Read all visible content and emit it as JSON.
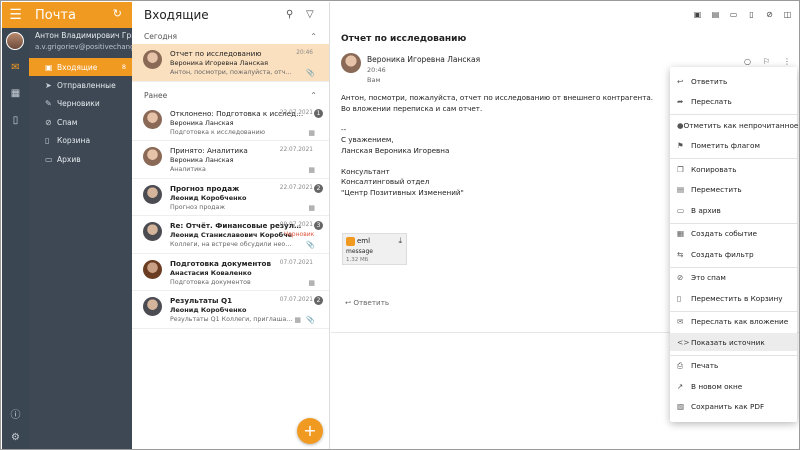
{
  "app": {
    "title": "Почта"
  },
  "account": {
    "name": "Антон Владимирович Григорьев",
    "email": "a.v.grigoriev@positivechange.ru"
  },
  "folders": [
    {
      "label": "Входящие",
      "count": "8",
      "icon": "inbox-icon"
    },
    {
      "label": "Отправленные",
      "count": "",
      "icon": "send-icon"
    },
    {
      "label": "Черновики",
      "count": "",
      "icon": "draft-icon"
    },
    {
      "label": "Спам",
      "count": "",
      "icon": "spam-icon"
    },
    {
      "label": "Корзина",
      "count": "",
      "icon": "trash-icon"
    },
    {
      "label": "Архив",
      "count": "",
      "icon": "archive-icon"
    }
  ],
  "list": {
    "title": "Входящие",
    "groups": {
      "today": "Сегодня",
      "earlier": "Ранее"
    },
    "messages": [
      {
        "subject": "Отчет по исследованию",
        "from": "Вероника Игоревна Ланская",
        "snippet": "Антон, посмотри, пожалуйста, отчет по внеш...",
        "date": "20:46",
        "count": "",
        "draft": "",
        "unread": false
      },
      {
        "subject": "Отклонено: Подготовка к исследованию",
        "from": "Вероника Ланская",
        "snippet": "Подготовка к исследованию",
        "date": "22.07.2021",
        "count": "1",
        "draft": "",
        "unread": false
      },
      {
        "subject": "Принято: Аналитика",
        "from": "Вероника Ланская",
        "snippet": "Аналитика",
        "date": "22.07.2021",
        "count": "",
        "draft": "",
        "unread": false
      },
      {
        "subject": "Прогноз продаж",
        "from": "Леонид Коробченко",
        "snippet": "Прогноз продаж",
        "date": "22.07.2021",
        "count": "2",
        "draft": "",
        "unread": true
      },
      {
        "subject": "Re: Отчёт. Финансовые результаты",
        "from": "Леонид Станиславович Коробче",
        "snippet": "Коллеги, на встрече обсудили необходим...",
        "date": "09.07.2021",
        "count": "3",
        "draft": "Черновик",
        "unread": true
      },
      {
        "subject": "Подготовка документов",
        "from": "Анастасия Коваленко",
        "snippet": "Подготовка документов",
        "date": "07.07.2021",
        "count": "",
        "draft": "",
        "unread": true
      },
      {
        "subject": "Результаты Q1",
        "from": "Леонид Коробченко",
        "snippet": "Результаты Q1 Коллеги, приглаша...",
        "date": "07.07.2021",
        "count": "2",
        "draft": "",
        "unread": true
      }
    ]
  },
  "reading": {
    "subject": "Отчет по исследованию",
    "from": "Вероника Игоревна Ланская",
    "time": "20:46",
    "to": "Вам",
    "body": [
      "Антон, посмотри, пожалуйста, отчет по исследованию от внешнего контрагента.",
      "Во вложении переписка и сам отчет.",
      "",
      "--",
      "С уважением,",
      "Ланская Вероника Игоревна",
      "",
      "Консультант",
      "Консалтинговый отдел",
      "\"Центр Позитивных Изменений\""
    ],
    "attachment": {
      "ext": "eml",
      "name": "message",
      "size": "1.32 МБ"
    },
    "reply_label": "Ответить"
  },
  "menu": {
    "items": [
      {
        "label": "Ответить",
        "icon": "reply-icon"
      },
      {
        "label": "Переслать",
        "icon": "forward-icon"
      },
      {
        "label": "Отметить как непрочитанное",
        "icon": "unread-dot-icon"
      },
      {
        "label": "Пометить флагом",
        "icon": "flag-icon"
      },
      {
        "label": "Копировать",
        "icon": "copy-icon"
      },
      {
        "label": "Переместить",
        "icon": "move-icon"
      },
      {
        "label": "В архив",
        "icon": "archive-icon"
      },
      {
        "label": "Создать событие",
        "icon": "calendar-icon"
      },
      {
        "label": "Создать фильтр",
        "icon": "filter-icon"
      },
      {
        "label": "Это спам",
        "icon": "spam-icon"
      },
      {
        "label": "Переместить в Корзину",
        "icon": "trash-icon"
      },
      {
        "label": "Переслать как вложение",
        "icon": "attach-forward-icon"
      },
      {
        "label": "Показать источник",
        "icon": "code-icon"
      },
      {
        "label": "Печать",
        "icon": "print-icon"
      },
      {
        "label": "В новом окне",
        "icon": "new-window-icon"
      },
      {
        "label": "Сохранить как PDF",
        "icon": "pdf-icon"
      }
    ],
    "hovered": "Показать источник"
  }
}
